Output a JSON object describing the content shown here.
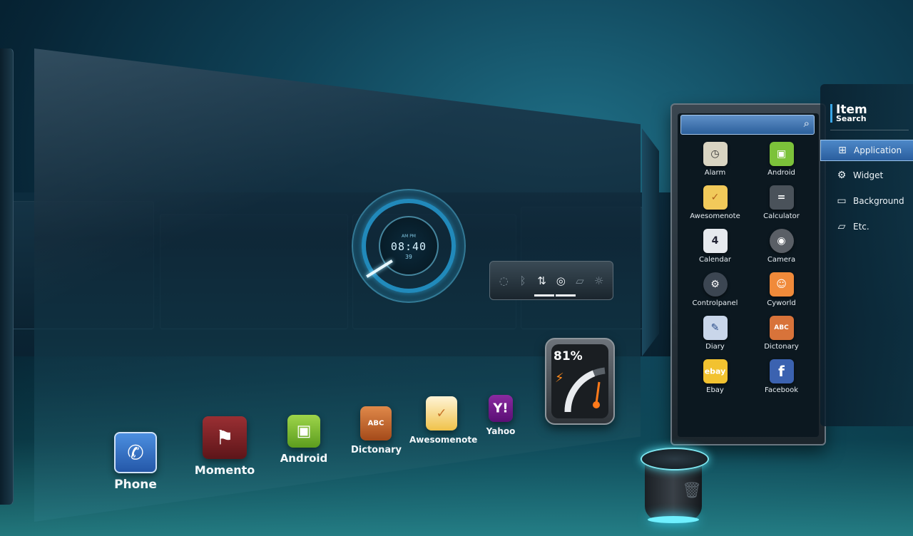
{
  "clock_widget": {
    "ampm": "AM  PM",
    "time": "08:40",
    "seconds": "39"
  },
  "quick_toggles": [
    "wifi-icon",
    "bluetooth-icon",
    "data-sync-icon",
    "gps-icon",
    "rotate-icon",
    "brightness-icon"
  ],
  "battery_widget": {
    "percent": "81%",
    "level": 0.81
  },
  "dock": [
    {
      "label": "Phone",
      "icon": "phone-icon"
    },
    {
      "label": "Momento",
      "icon": "bookmark-icon"
    },
    {
      "label": "Android",
      "icon": "android-icon"
    },
    {
      "label": "Dictonary",
      "icon": "book-icon"
    },
    {
      "label": "Awesomenote",
      "icon": "note-icon"
    },
    {
      "label": "Yahoo",
      "icon": "yahoo-icon"
    }
  ],
  "drawer": {
    "apps": [
      {
        "label": "Alarm",
        "glyph": "◷",
        "color": "#d9d4c2"
      },
      {
        "label": "Android",
        "glyph": "▣",
        "color": "#7cc23a"
      },
      {
        "label": "Awesomenote",
        "glyph": "✓",
        "color": "#f1c95a"
      },
      {
        "label": "Calculator",
        "glyph": "=",
        "color": "#4a525a"
      },
      {
        "label": "Calendar",
        "glyph": "4",
        "color": "#e6e9ee"
      },
      {
        "label": "Camera",
        "glyph": "◉",
        "color": "#5a5f66"
      },
      {
        "label": "Controlpanel",
        "glyph": "⚙",
        "color": "#3c4652"
      },
      {
        "label": "Cyworld",
        "glyph": "☺",
        "color": "#f08a3a"
      },
      {
        "label": "Diary",
        "glyph": "✎",
        "color": "#c9d6ea"
      },
      {
        "label": "Dictonary",
        "glyph": "A",
        "color": "#d8733a"
      },
      {
        "label": "Ebay",
        "glyph": "e",
        "color": "#f2c230"
      },
      {
        "label": "Facebook",
        "glyph": "f",
        "color": "#3b62b0"
      }
    ]
  },
  "item_menu": {
    "title": "Item",
    "subtitle": "Search",
    "items": [
      {
        "label": "Application",
        "icon": "grid-icon",
        "selected": true
      },
      {
        "label": "Widget",
        "icon": "gear-icon",
        "selected": false
      },
      {
        "label": "Background",
        "icon": "monitor-icon",
        "selected": false
      },
      {
        "label": "Etc.",
        "icon": "folder-icon",
        "selected": false
      }
    ]
  }
}
